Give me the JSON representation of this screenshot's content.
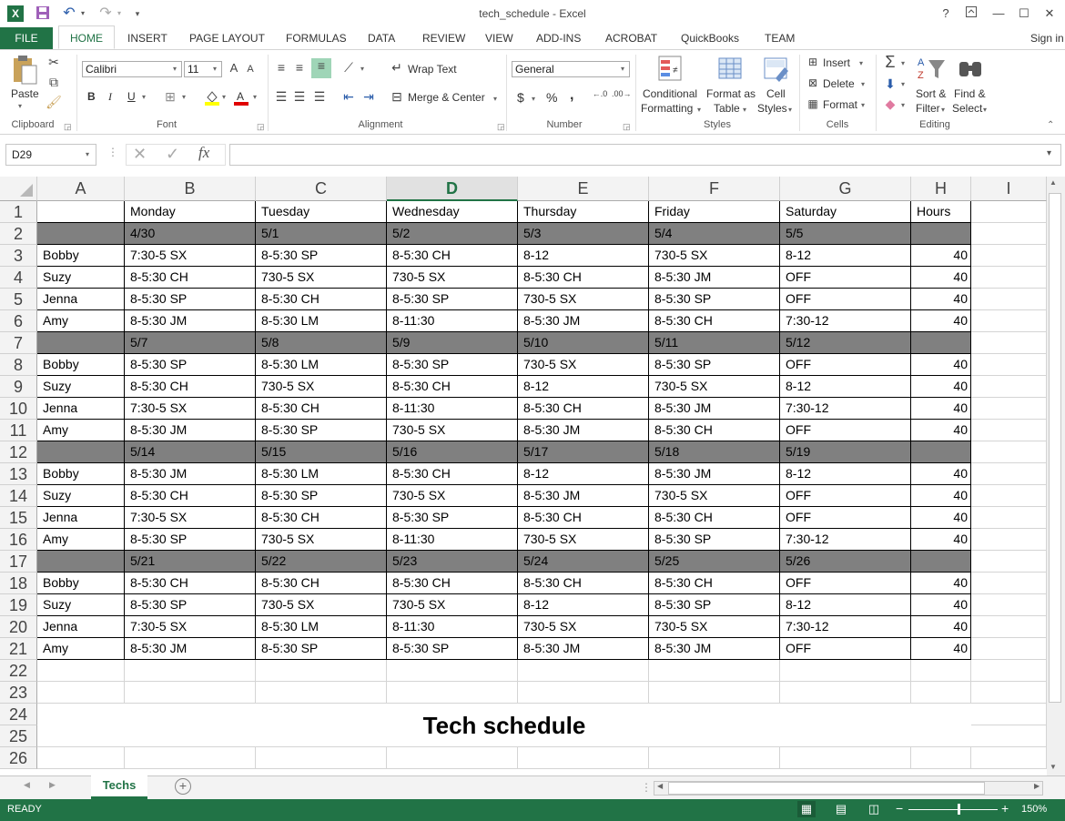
{
  "window": {
    "title": "tech_schedule - Excel",
    "help": "?",
    "sign_in": "Sign in"
  },
  "qat": {
    "undo_icon": "undo-icon",
    "redo_icon": "redo-icon"
  },
  "tabs": [
    "FILE",
    "HOME",
    "INSERT",
    "PAGE LAYOUT",
    "FORMULAS",
    "DATA",
    "REVIEW",
    "VIEW",
    "ADD-INS",
    "ACROBAT",
    "QuickBooks",
    "TEAM"
  ],
  "ribbon": {
    "clipboard": {
      "label": "Clipboard",
      "paste": "Paste"
    },
    "font": {
      "label": "Font",
      "name": "Calibri",
      "size": "11",
      "bold": "B",
      "italic": "I",
      "underline": "U"
    },
    "alignment": {
      "label": "Alignment",
      "wrap": "Wrap Text",
      "merge": "Merge & Center"
    },
    "number": {
      "label": "Number",
      "format": "General",
      "currency": "$",
      "percent": "%",
      "comma": ","
    },
    "styles": {
      "label": "Styles",
      "cond1": "Conditional",
      "cond2": "Formatting",
      "fmt1": "Format as",
      "fmt2": "Table",
      "cell1": "Cell",
      "cell2": "Styles"
    },
    "cells": {
      "label": "Cells",
      "insert": "Insert",
      "delete": "Delete",
      "format": "Format"
    },
    "editing": {
      "label": "Editing",
      "sort1": "Sort &",
      "sort2": "Filter",
      "find1": "Find &",
      "find2": "Select"
    }
  },
  "formula_bar": {
    "name_box": "D29",
    "fx": "fx",
    "value": ""
  },
  "columns": [
    "A",
    "B",
    "C",
    "D",
    "E",
    "F",
    "G",
    "H",
    "I"
  ],
  "selected_column": "D",
  "rows": [
    "1",
    "2",
    "3",
    "4",
    "5",
    "6",
    "7",
    "8",
    "9",
    "10",
    "11",
    "12",
    "13",
    "14",
    "15",
    "16",
    "17",
    "18",
    "19",
    "20",
    "21",
    "22",
    "23",
    "24",
    "25",
    "26"
  ],
  "sheet": {
    "header": [
      "",
      "Monday",
      "Tuesday",
      "Wednesday",
      "Thursday",
      "Friday",
      "Saturday",
      "Hours"
    ],
    "weeks": [
      {
        "dates": [
          "4/30",
          "5/1",
          "5/2",
          "5/3",
          "5/4",
          "5/5"
        ],
        "people": [
          [
            "Bobby",
            "7:30-5 SX",
            "8-5:30 SP",
            "8-5:30 CH",
            "8-12",
            "730-5 SX",
            "8-12",
            "40"
          ],
          [
            "Suzy",
            "8-5:30 CH",
            "730-5 SX",
            "730-5 SX",
            "8-5:30 CH",
            "8-5:30 JM",
            "OFF",
            "40"
          ],
          [
            "Jenna",
            "8-5:30 SP",
            "8-5:30 CH",
            "8-5:30 SP",
            "730-5 SX",
            "8-5:30 SP",
            "OFF",
            "40"
          ],
          [
            "Amy",
            "8-5:30 JM",
            "8-5:30 LM",
            "8-11:30",
            "8-5:30 JM",
            "8-5:30 CH",
            "7:30-12",
            "40"
          ]
        ]
      },
      {
        "dates": [
          "5/7",
          "5/8",
          "5/9",
          "5/10",
          "5/11",
          "5/12"
        ],
        "people": [
          [
            "Bobby",
            "8-5:30 SP",
            "8-5:30 LM",
            "8-5:30 SP",
            "730-5 SX",
            "8-5:30 SP",
            "OFF",
            "40"
          ],
          [
            "Suzy",
            "8-5:30 CH",
            "730-5 SX",
            "8-5:30 CH",
            "8-12",
            "730-5 SX",
            "8-12",
            "40"
          ],
          [
            "Jenna",
            "7:30-5 SX",
            "8-5:30 CH",
            "8-11:30",
            "8-5:30 CH",
            "8-5:30 JM",
            "7:30-12",
            "40"
          ],
          [
            "Amy",
            "8-5:30 JM",
            "8-5:30 SP",
            "730-5 SX",
            "8-5:30 JM",
            "8-5:30 CH",
            "OFF",
            "40"
          ]
        ]
      },
      {
        "dates": [
          "5/14",
          "5/15",
          "5/16",
          "5/17",
          "5/18",
          "5/19"
        ],
        "people": [
          [
            "Bobby",
            "8-5:30 JM",
            "8-5:30 LM",
            "8-5:30 CH",
            "8-12",
            "8-5:30 JM",
            "8-12",
            "40"
          ],
          [
            "Suzy",
            "8-5:30 CH",
            "8-5:30 SP",
            "730-5 SX",
            "8-5:30 JM",
            "730-5 SX",
            "OFF",
            "40"
          ],
          [
            "Jenna",
            "7:30-5 SX",
            "8-5:30 CH",
            "8-5:30 SP",
            "8-5:30 CH",
            "8-5:30 CH",
            "OFF",
            "40"
          ],
          [
            "Amy",
            "8-5:30 SP",
            "730-5 SX",
            "8-11:30",
            "730-5 SX",
            "8-5:30 SP",
            "7:30-12",
            "40"
          ]
        ]
      },
      {
        "dates": [
          "5/21",
          "5/22",
          "5/23",
          "5/24",
          "5/25",
          "5/26"
        ],
        "people": [
          [
            "Bobby",
            "8-5:30 CH",
            "8-5:30 CH",
            "8-5:30 CH",
            "8-5:30 CH",
            "8-5:30 CH",
            "OFF",
            "40"
          ],
          [
            "Suzy",
            "8-5:30 SP",
            "730-5 SX",
            "730-5 SX",
            "8-12",
            "8-5:30 SP",
            "8-12",
            "40"
          ],
          [
            "Jenna",
            "7:30-5 SX",
            "8-5:30 LM",
            "8-11:30",
            "730-5 SX",
            "730-5 SX",
            "7:30-12",
            "40"
          ],
          [
            "Amy",
            "8-5:30 JM",
            "8-5:30 SP",
            "8-5:30 SP",
            "8-5:30 JM",
            "8-5:30 JM",
            "OFF",
            "40"
          ]
        ]
      }
    ],
    "title": "Tech schedule"
  },
  "sheet_tabs": [
    "Techs"
  ],
  "status": {
    "ready": "READY",
    "zoom": "150%"
  },
  "colors": {
    "excel_green": "#217346",
    "band_gray": "#808080"
  }
}
